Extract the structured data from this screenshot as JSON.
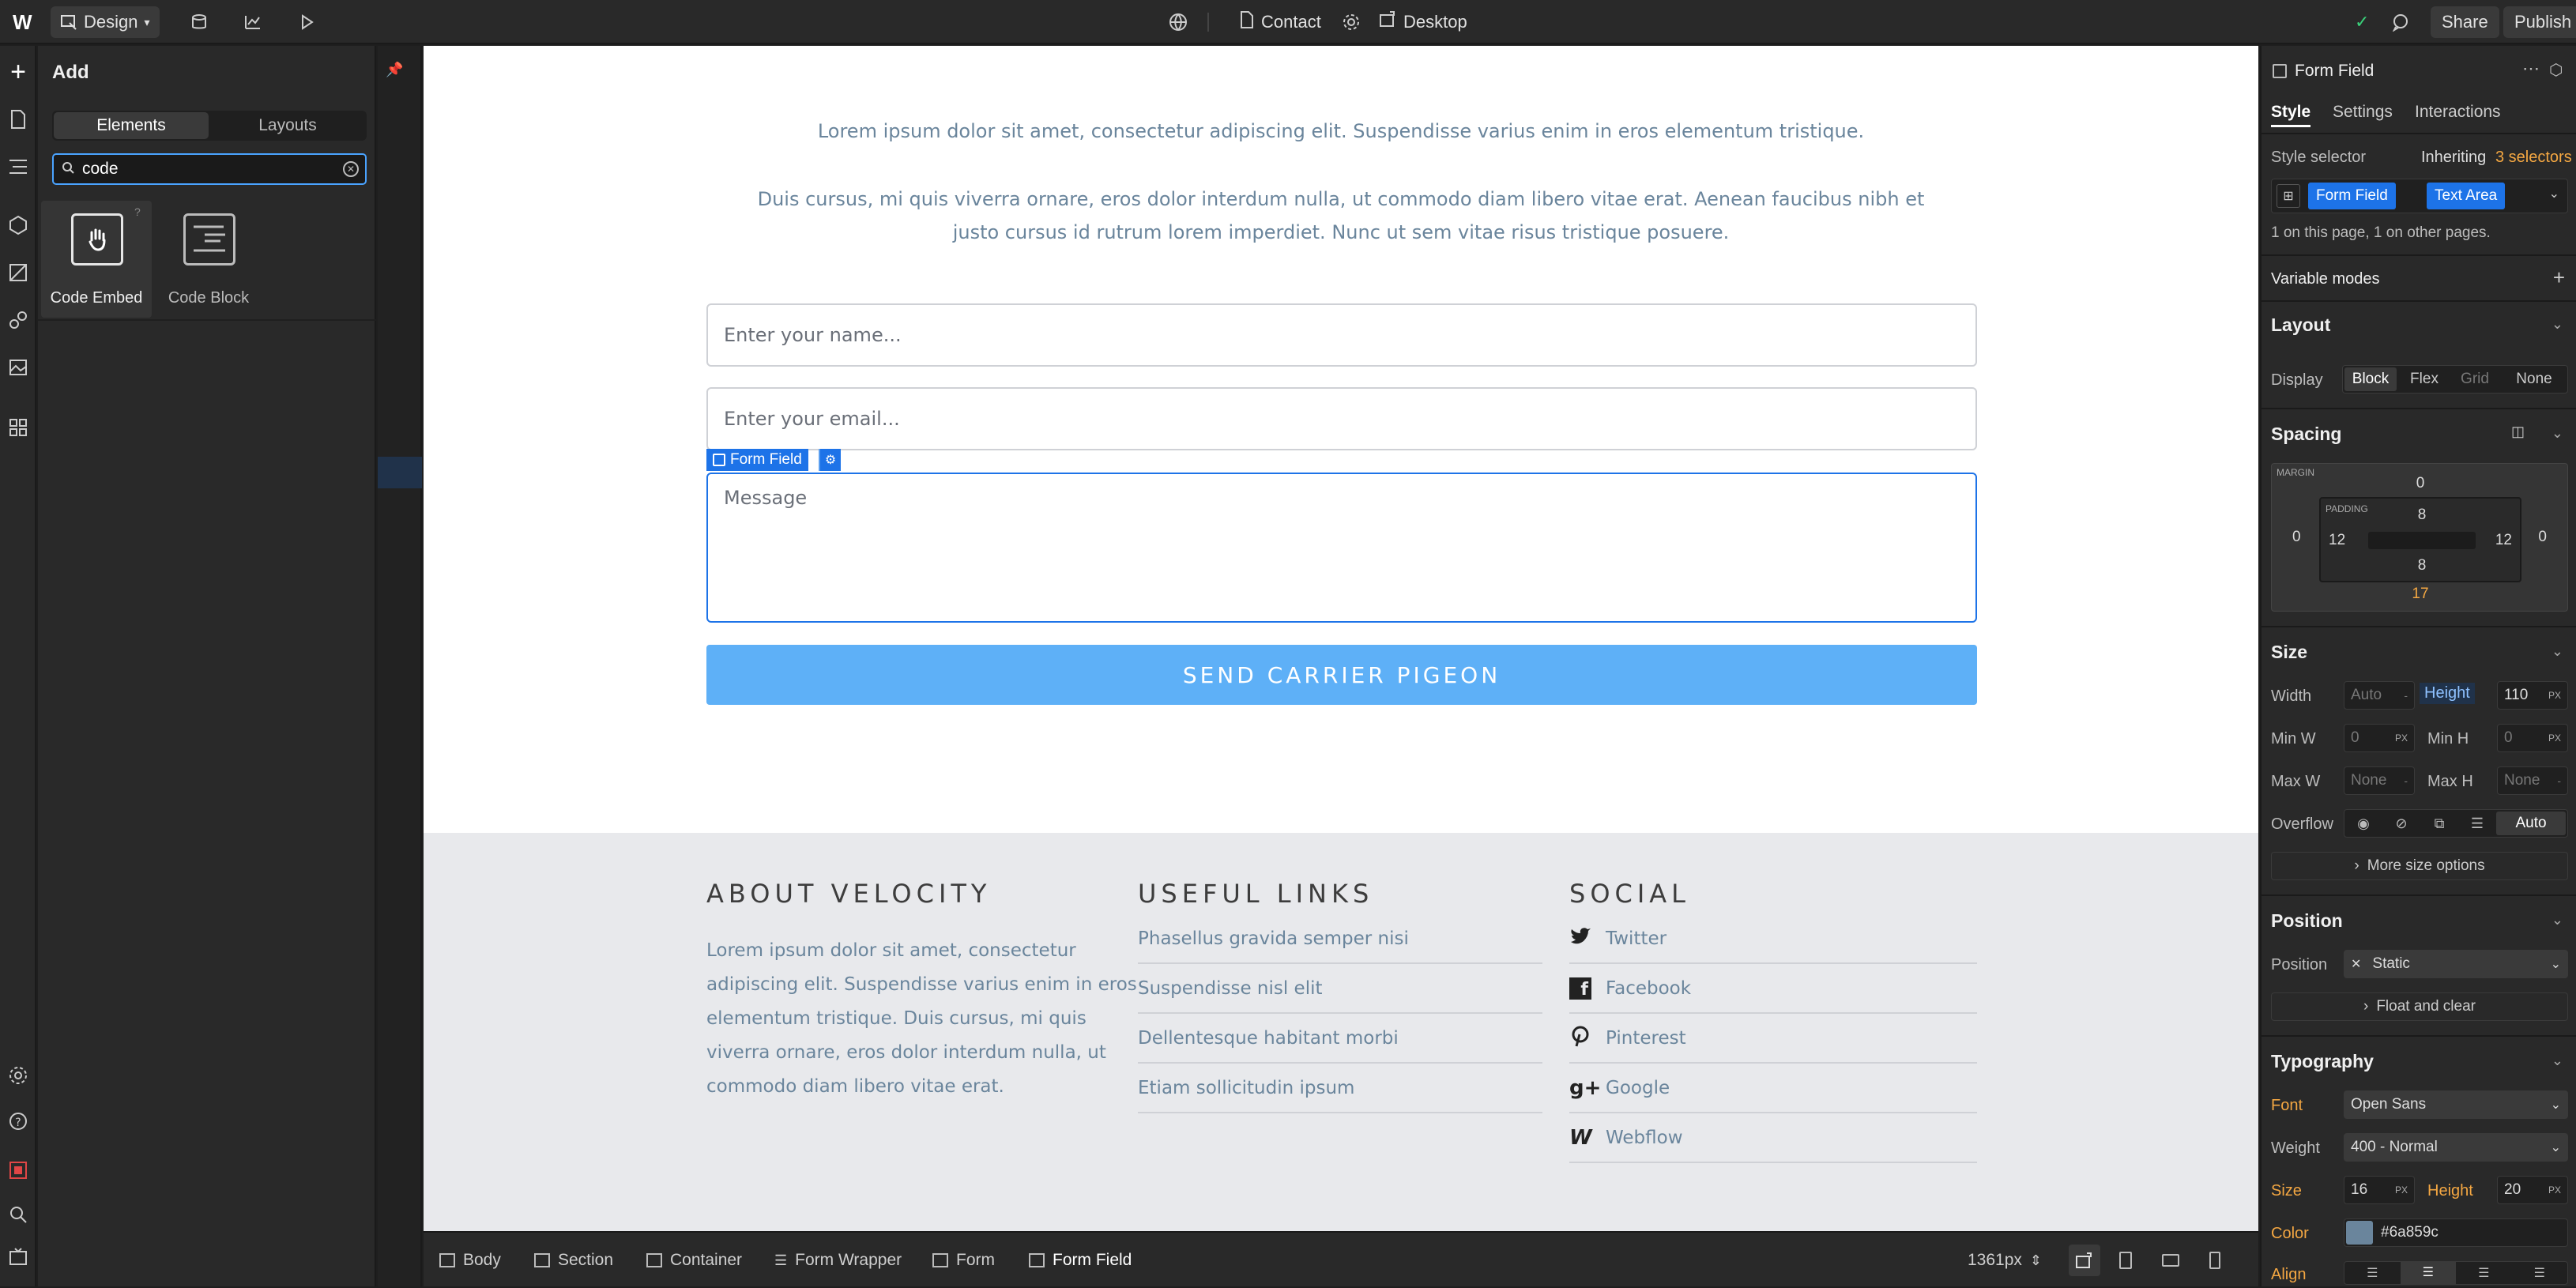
{
  "topbar": {
    "mode_label": "Design",
    "page_label": "Contact",
    "breakpoint_label": "Desktop",
    "share_label": "Share",
    "publish_label": "Publish"
  },
  "add_panel": {
    "title": "Add",
    "tabs": [
      "Elements",
      "Layouts"
    ],
    "search_value": "code",
    "results": [
      {
        "label": "Code Embed",
        "icon": "hand-cursor-icon"
      },
      {
        "label": "Code Block",
        "icon": "code-block-icon"
      }
    ]
  },
  "canvas": {
    "intro_p1": "Lorem ipsum dolor sit amet, consectetur adipiscing elit. Suspendisse varius enim in eros elementum tristique.",
    "intro_p2_line1": "Duis cursus, mi quis viverra ornare, eros dolor interdum nulla, ut commodo diam libero vitae erat. Aenean faucibus nibh et",
    "intro_p2_line2": "justo cursus id rutrum lorem imperdiet. Nunc ut sem vitae risus tristique posuere.",
    "name_placeholder": "Enter your name...",
    "email_placeholder": "Enter your email...",
    "message_placeholder": "Message",
    "selected_tag": "Form Field",
    "submit_label": "SEND CARRIER PIGEON",
    "footer": {
      "about_title": "ABOUT VELOCITY",
      "about_lines": [
        "Lorem ipsum dolor sit amet, consectetur",
        "adipiscing elit. Suspendisse varius enim in eros",
        "elementum tristique. Duis cursus, mi quis",
        "viverra ornare, eros dolor interdum nulla, ut",
        "commodo diam libero vitae erat."
      ],
      "links_title": "USEFUL LINKS",
      "links": [
        "Phasellus gravida semper nisi",
        "Suspendisse nisl elit",
        "Dellentesque habitant morbi",
        "Etiam sollicitudin ipsum"
      ],
      "social_title": "SOCIAL",
      "social": [
        {
          "label": "Twitter",
          "icon": "twitter-icon"
        },
        {
          "label": "Facebook",
          "icon": "facebook-icon"
        },
        {
          "label": "Pinterest",
          "icon": "pinterest-icon"
        },
        {
          "label": "Google",
          "icon": "google-plus-icon"
        },
        {
          "label": "Webflow",
          "icon": "webflow-icon"
        }
      ]
    }
  },
  "breadcrumb": {
    "items": [
      "Body",
      "Section",
      "Container",
      "Form Wrapper",
      "Form",
      "Form Field"
    ],
    "width_readout": "1361px"
  },
  "right_panel": {
    "element_name": "Form Field",
    "tabs": [
      "Style",
      "Settings",
      "Interactions"
    ],
    "style_selector_label": "Style selector",
    "inheriting_label": "Inheriting",
    "selectors_count": "3 selectors",
    "chips": [
      "Form Field",
      "Text Area"
    ],
    "usage_text": "1 on this page, 1 on other pages.",
    "variable_modes": "Variable modes",
    "layout": {
      "title": "Layout",
      "display_label": "Display",
      "options": [
        "Block",
        "Flex",
        "Grid",
        "None"
      ]
    },
    "spacing": {
      "title": "Spacing",
      "margin_label": "MARGIN",
      "padding_label": "PADDING",
      "margin": {
        "top": "0",
        "left": "0",
        "right": "0",
        "bottom": "17"
      },
      "padding": {
        "top": "8",
        "left": "12",
        "right": "12",
        "bottom": "8"
      }
    },
    "size": {
      "title": "Size",
      "width_label": "Width",
      "width_value": "Auto",
      "height_label": "Height",
      "height_value": "110",
      "minw_label": "Min W",
      "minw_value": "0",
      "minh_label": "Min H",
      "minh_value": "0",
      "maxw_label": "Max W",
      "maxw_value": "None",
      "maxh_label": "Max H",
      "maxh_value": "None",
      "overflow_label": "Overflow",
      "overflow_auto": "Auto",
      "unit": "PX",
      "more": "More size options"
    },
    "position": {
      "title": "Position",
      "label": "Position",
      "value": "Static",
      "float": "Float and clear"
    },
    "typography": {
      "title": "Typography",
      "font_label": "Font",
      "font_value": "Open Sans",
      "weight_label": "Weight",
      "weight_value": "400 - Normal",
      "size_label": "Size",
      "size_value": "16",
      "height_label": "Height",
      "height_value": "20",
      "color_label": "Color",
      "color_value": "#6a859c",
      "align_label": "Align"
    }
  },
  "colors": {
    "accent": "#1d73e8",
    "button": "#5eb0f7",
    "link": "#6a859c"
  }
}
